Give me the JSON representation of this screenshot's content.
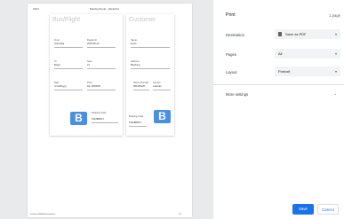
{
  "preview": {
    "header_left": "4/8/24",
    "header_center": "Boarding Receipt – Wanderlust",
    "footer_left": "localhost:8080/booking/ticket",
    "footer_right": "1/1",
    "left_card": {
      "title": "Bus/Flight",
      "fields": [
        {
          "label": "From",
          "value": "Indonesia"
        },
        {
          "label": "Depart At",
          "value": "2018-08-16"
        },
        {
          "label": "To",
          "value": "Bogor"
        },
        {
          "label": "Seat",
          "value": "21"
        },
        {
          "label": "Date",
          "value": "mm/dd/yyyy"
        },
        {
          "label": "Price",
          "value": "Rp. 2000000"
        }
      ],
      "booking_code_label": "Booking Code",
      "booking_code_value": "1542B89GT",
      "logo_letter": "B"
    },
    "right_card": {
      "title": "Customer",
      "fields": [
        {
          "label": "Name",
          "value": "Fauzi"
        },
        {
          "label": "Address",
          "value": "Bandung"
        },
        {
          "label": "Phone Number",
          "value": "081345125"
        },
        {
          "label": "Gender",
          "value": "Laki-laki"
        }
      ],
      "booking_code_label": "Booking Code",
      "booking_code_value": "1542B89GT",
      "logo_letter": "B"
    }
  },
  "panel": {
    "title": "Print",
    "page_count": "1 page",
    "destination_label": "Destination",
    "destination_value": "Save as PDF",
    "pages_label": "Pages",
    "pages_value": "All",
    "layout_label": "Layout",
    "layout_value": "Portrait",
    "more_settings": "More settings",
    "save_button": "Save",
    "cancel_button": "Cancel"
  }
}
